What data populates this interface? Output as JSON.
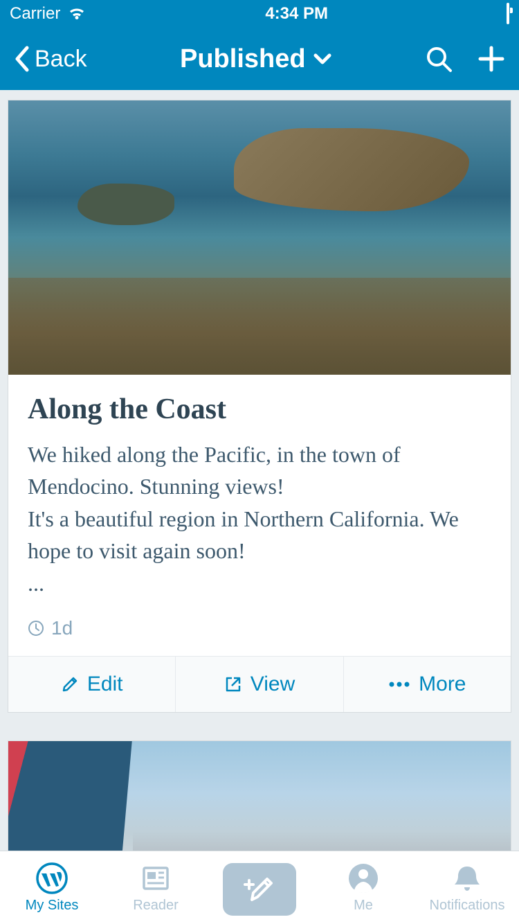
{
  "status": {
    "carrier": "Carrier",
    "time": "4:34 PM"
  },
  "nav": {
    "back": "Back",
    "title": "Published"
  },
  "post": {
    "title": "Along the Coast",
    "excerpt": "We hiked along the Pacific, in the town of Mendocino. Stunning views!\nIt's a beautiful region in Northern California. We hope to visit again soon!\n...",
    "age": "1d",
    "actions": {
      "edit": "Edit",
      "view": "View",
      "more": "More"
    }
  },
  "tabs": {
    "mysites": "My Sites",
    "reader": "Reader",
    "me": "Me",
    "notifications": "Notifications"
  }
}
